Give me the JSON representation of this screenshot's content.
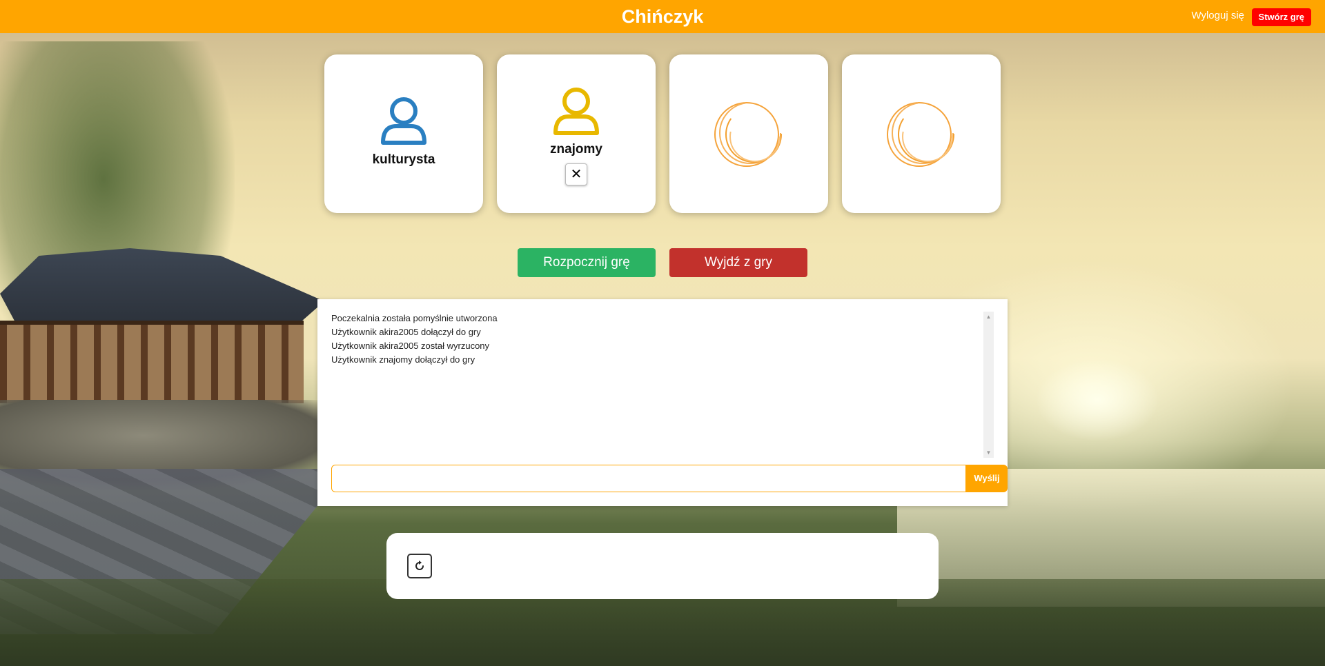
{
  "header": {
    "title": "Chińczyk",
    "logout_label": "Wyloguj się",
    "create_label": "Stwórz grę",
    "accent_color": "#ffa500",
    "create_color": "#ff0000"
  },
  "players": [
    {
      "name": "kulturysta",
      "color": "#2a7fc1",
      "state": "joined",
      "kickable": false
    },
    {
      "name": "znajomy",
      "color": "#e8b800",
      "state": "joined",
      "kickable": true,
      "kick_icon": "close-icon"
    },
    {
      "state": "waiting",
      "icon": "loading-spinner-icon"
    },
    {
      "state": "waiting",
      "icon": "loading-spinner-icon"
    }
  ],
  "actions": {
    "start_label": "Rozpocznij grę",
    "leave_label": "Wyjdź z gry",
    "start_color": "#2bb363",
    "leave_color": "#c2312c"
  },
  "chat": {
    "messages": [
      "Poczekalnia została pomyślnie utworzona",
      "Użytkownik akira2005 dołączył do gry",
      "Użytkownik akira2005 został wyrzucony",
      "Użytkownik znajomy dołączył do gry"
    ],
    "input_value": "",
    "send_label": "Wyślij"
  },
  "panel": {
    "refresh_icon": "refresh-icon"
  }
}
